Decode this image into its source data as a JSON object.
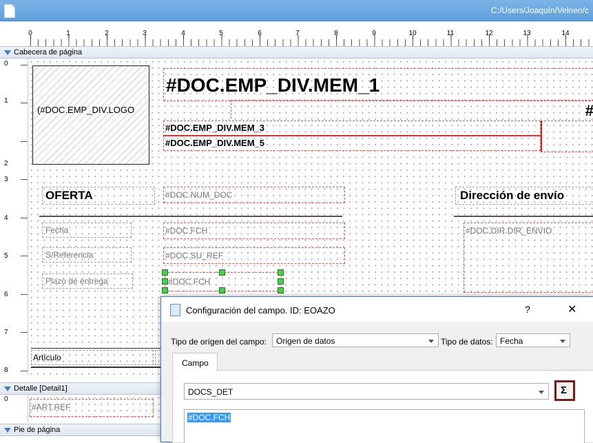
{
  "window": {
    "path": "C:/Users/Joaquín/Velneo/c"
  },
  "ruler": {
    "h_labels": [
      "0",
      "1",
      "2",
      "3",
      "4",
      "5",
      "6",
      "7",
      "8",
      "9",
      "10",
      "11",
      "12",
      "13",
      "14"
    ]
  },
  "vruler_header": {
    "labels": [
      "0",
      "1",
      "2",
      "3",
      "4",
      "5",
      "6",
      "7",
      "8"
    ]
  },
  "vruler_detail": {
    "labels": [
      "0"
    ]
  },
  "bands": {
    "header": "Cabecera de página",
    "detail": "Detalle [Detail1]",
    "footer": "Pie de página"
  },
  "report": {
    "logo": "(#DOC.EMP_DIV.LOGO",
    "mem1": "#DOC.EMP_DIV.MEM_1",
    "hash": "#",
    "mem3": "#DOC.EMP_DIV.MEM_3",
    "mem5": "#DOC.EMP_DIV.MEM_5",
    "oferta": "OFERTA",
    "num_doc": "#DOC.NUM_DOC",
    "direccion": "Dirección de envío",
    "fecha_label": "Fecha",
    "fecha_value": "#DOC.FCH",
    "dir_envio": "#DOC.DIR.DIR_ENVIO",
    "sref_label": "S/Referencia",
    "sref_value": "#DOC.SU_REF",
    "plazo_label": "Plazo de entrega",
    "plazo_value": "#DOC.FCH",
    "articulo": "Artículo",
    "art_ref": "#ART.REF"
  },
  "dialog": {
    "title": "Configuración del campo. ID: EOAZO",
    "help": "?",
    "close": "✕",
    "origin_label": "Tipo de orígen del campo:",
    "origin_value": "Origen de datos",
    "type_label": "Tipo de datos:",
    "type_value": "Fecha",
    "tab": "Campo",
    "table_value": "DOCS_DET",
    "sigma": "Σ",
    "expression": "#DOC.FCH"
  }
}
